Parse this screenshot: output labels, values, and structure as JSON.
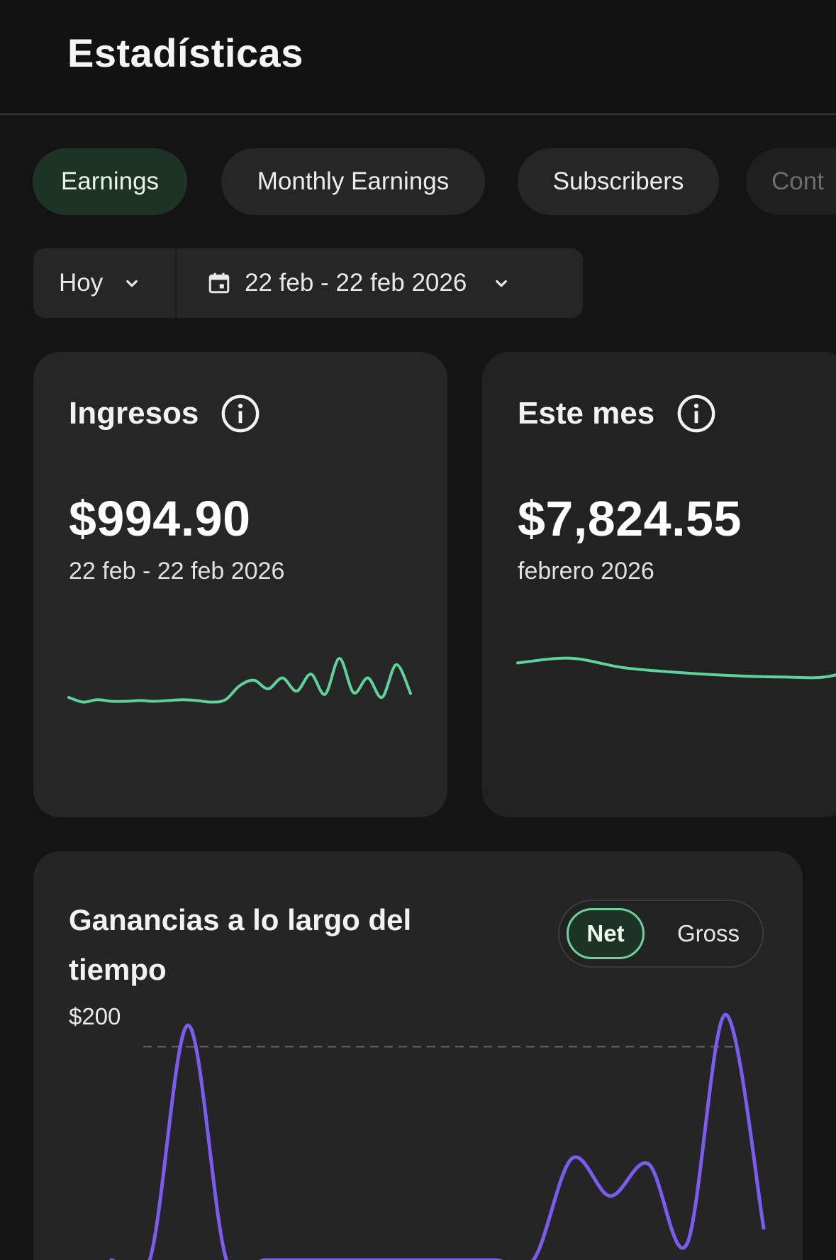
{
  "header": {
    "title": "Estadísticas"
  },
  "tabs": [
    {
      "label": "Earnings",
      "active": true
    },
    {
      "label": "Monthly Earnings",
      "active": false
    },
    {
      "label": "Subscribers",
      "active": false
    },
    {
      "label": "Cont",
      "active": false
    }
  ],
  "date_filter": {
    "period": "Hoy",
    "range": "22 feb - 22 feb 2026",
    "icons": [
      "chevron-down-icon",
      "calendar-icon"
    ]
  },
  "cards": {
    "income": {
      "title": "Ingresos",
      "value": "$994.90",
      "subtitle": "22 feb - 22 feb 2026"
    },
    "month": {
      "title": "Este mes",
      "value": "$7,824.55",
      "subtitle": "febrero 2026"
    }
  },
  "colors": {
    "accent_green": "#5fd29c",
    "accent_purple": "#7b5cf0",
    "active_tab_bg": "#1c3326"
  },
  "earnings_chart": {
    "title": "Ganancias a lo largo del tiempo",
    "toggle": {
      "net_label": "Net",
      "gross_label": "Gross",
      "selected": "Net"
    },
    "y_tick_label": "$200"
  },
  "chart_data": [
    {
      "type": "line",
      "title": "",
      "series": [
        {
          "values": [
            30,
            24,
            27,
            25,
            25,
            26,
            25,
            26,
            27,
            26,
            24,
            27,
            45,
            52,
            41,
            55,
            38,
            60,
            34,
            80,
            36,
            55,
            30,
            72,
            35
          ]
        }
      ],
      "ylim": [
        0,
        100
      ]
    },
    {
      "type": "line",
      "title": "",
      "series": [
        {
          "values": [
            56,
            62,
            50,
            44,
            40,
            38,
            40,
            70
          ]
        }
      ],
      "ylim": [
        0,
        100
      ]
    },
    {
      "type": "line",
      "title": "",
      "y_ticks": [
        "$200"
      ],
      "series": [
        {
          "values": [
            0,
            0,
            220,
            0,
            0,
            0,
            0,
            0,
            0,
            0,
            0,
            0,
            95,
            60,
            90,
            15,
            230,
            30
          ]
        }
      ],
      "ylim": [
        0,
        250
      ]
    }
  ]
}
